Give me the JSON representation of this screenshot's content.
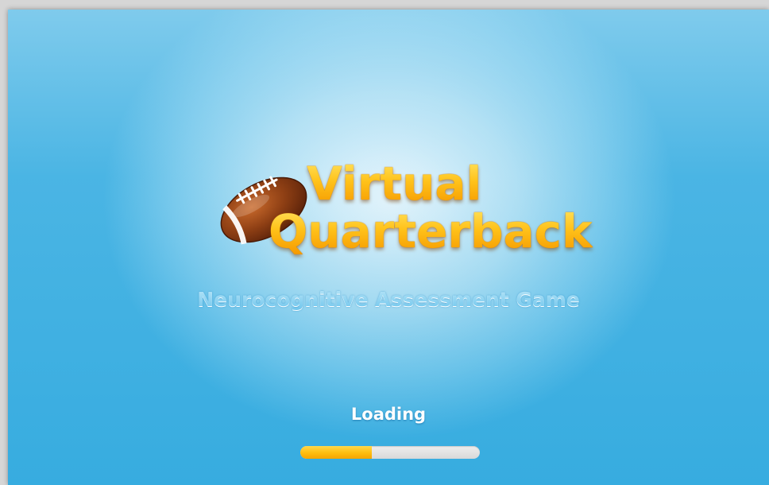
{
  "game": {
    "title_line_1": "Virtual",
    "title_line_2": "Quarterback",
    "subtitle": "Neurocognitive Assessment Game"
  },
  "loading": {
    "label": "Loading",
    "progress_fraction": 0.4
  },
  "icons": {
    "logo_icon": "football-icon"
  },
  "colors": {
    "title_gold": "#ffc21a",
    "subtitle_blue": "#6cc4ec",
    "background_blue": "#3fb0e2",
    "progress_fill": "#ffbf12",
    "progress_track": "#dddddd"
  }
}
